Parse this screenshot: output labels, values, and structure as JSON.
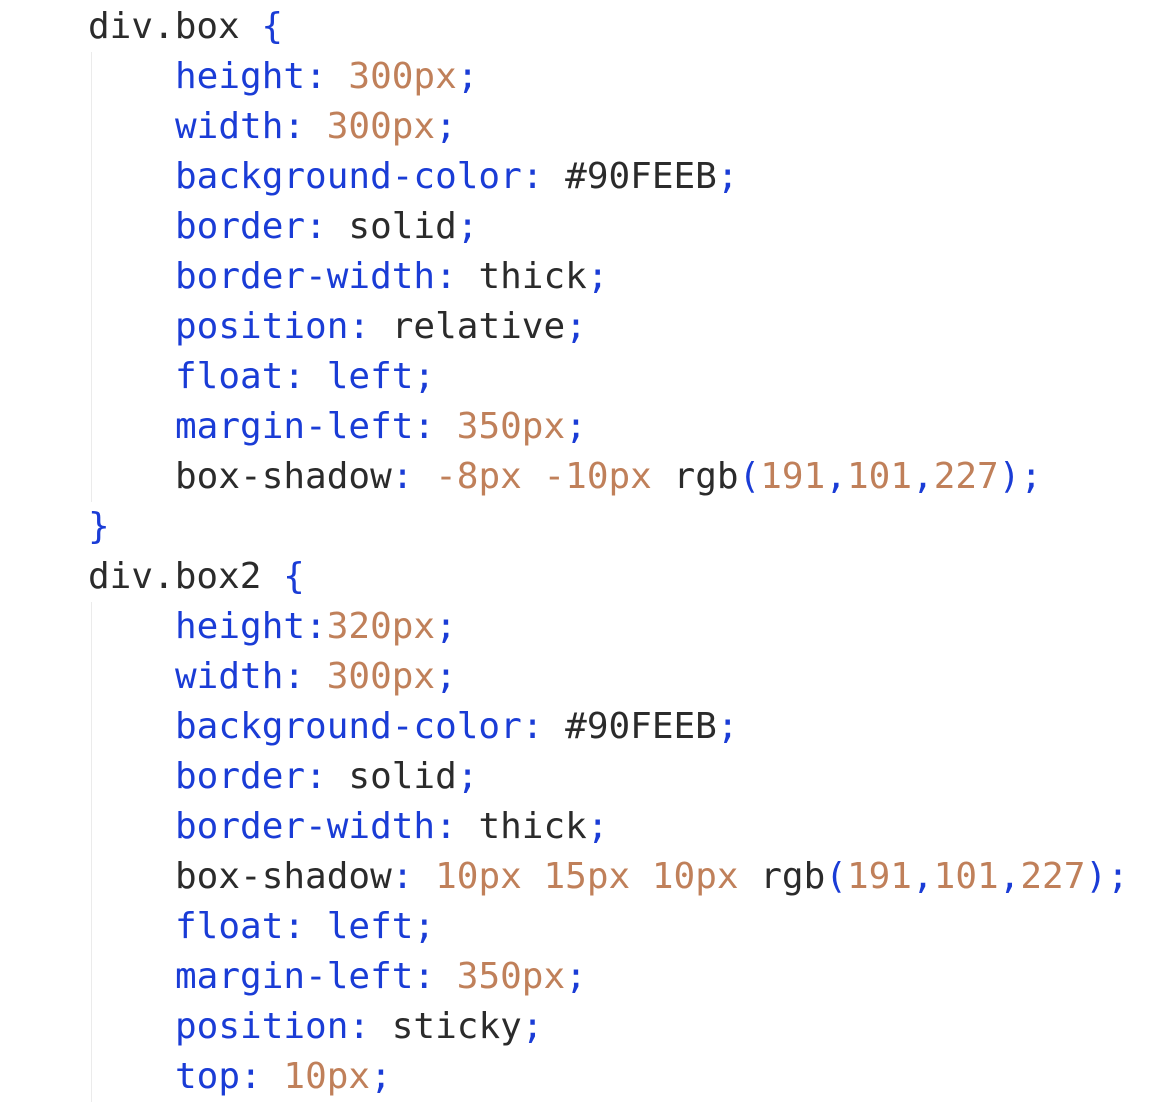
{
  "colors": {
    "selector": "#2b2b2b",
    "brace": "#1a3cd6",
    "property": "#1a3cd6",
    "punctuation": "#1a3cd6",
    "number": "#c0805a",
    "keyword": "#1a3cd6",
    "plain": "#2b2b2b",
    "background": "#ffffff"
  },
  "lines": [
    {
      "indent": false,
      "tokens": [
        {
          "t": "sel",
          "v": "div.box "
        },
        {
          "t": "brace",
          "v": "{"
        }
      ]
    },
    {
      "indent": true,
      "tokens": [
        {
          "t": "prop",
          "v": "height"
        },
        {
          "t": "punct",
          "v": ": "
        },
        {
          "t": "num",
          "v": "300px"
        },
        {
          "t": "punct",
          "v": ";"
        }
      ]
    },
    {
      "indent": true,
      "tokens": [
        {
          "t": "prop",
          "v": "width"
        },
        {
          "t": "punct",
          "v": ": "
        },
        {
          "t": "num",
          "v": "300px"
        },
        {
          "t": "punct",
          "v": ";"
        }
      ]
    },
    {
      "indent": true,
      "tokens": [
        {
          "t": "prop",
          "v": "background-color"
        },
        {
          "t": "punct",
          "v": ": "
        },
        {
          "t": "plain",
          "v": "#90FEEB"
        },
        {
          "t": "punct",
          "v": ";"
        }
      ]
    },
    {
      "indent": true,
      "tokens": [
        {
          "t": "prop",
          "v": "border"
        },
        {
          "t": "punct",
          "v": ": "
        },
        {
          "t": "plain",
          "v": "solid"
        },
        {
          "t": "punct",
          "v": ";"
        }
      ]
    },
    {
      "indent": true,
      "tokens": [
        {
          "t": "prop",
          "v": "border-width"
        },
        {
          "t": "punct",
          "v": ": "
        },
        {
          "t": "plain",
          "v": "thick"
        },
        {
          "t": "punct",
          "v": ";"
        }
      ]
    },
    {
      "indent": true,
      "tokens": [
        {
          "t": "prop",
          "v": "position"
        },
        {
          "t": "punct",
          "v": ": "
        },
        {
          "t": "plain",
          "v": "relative"
        },
        {
          "t": "punct",
          "v": ";"
        }
      ]
    },
    {
      "indent": true,
      "tokens": [
        {
          "t": "prop",
          "v": "float"
        },
        {
          "t": "punct",
          "v": ": "
        },
        {
          "t": "kw",
          "v": "left"
        },
        {
          "t": "punct",
          "v": ";"
        }
      ]
    },
    {
      "indent": true,
      "tokens": [
        {
          "t": "prop",
          "v": "margin-left"
        },
        {
          "t": "punct",
          "v": ": "
        },
        {
          "t": "num",
          "v": "350px"
        },
        {
          "t": "punct",
          "v": ";"
        }
      ]
    },
    {
      "indent": true,
      "tokens": [
        {
          "t": "plain",
          "v": "box-shadow"
        },
        {
          "t": "punct",
          "v": ": "
        },
        {
          "t": "num",
          "v": "-8px -10px "
        },
        {
          "t": "plain",
          "v": "rgb"
        },
        {
          "t": "punct",
          "v": "("
        },
        {
          "t": "num",
          "v": "191"
        },
        {
          "t": "punct",
          "v": ","
        },
        {
          "t": "num",
          "v": "101"
        },
        {
          "t": "punct",
          "v": ","
        },
        {
          "t": "num",
          "v": "227"
        },
        {
          "t": "punct",
          "v": ");"
        }
      ]
    },
    {
      "indent": false,
      "tokens": [
        {
          "t": "brace",
          "v": "}"
        }
      ]
    },
    {
      "indent": false,
      "tokens": [
        {
          "t": "sel",
          "v": "div.box2 "
        },
        {
          "t": "brace",
          "v": "{"
        }
      ]
    },
    {
      "indent": true,
      "tokens": [
        {
          "t": "prop",
          "v": "height"
        },
        {
          "t": "punct",
          "v": ":"
        },
        {
          "t": "num",
          "v": "320px"
        },
        {
          "t": "punct",
          "v": ";"
        }
      ]
    },
    {
      "indent": true,
      "tokens": [
        {
          "t": "prop",
          "v": "width"
        },
        {
          "t": "punct",
          "v": ": "
        },
        {
          "t": "num",
          "v": "300px"
        },
        {
          "t": "punct",
          "v": ";"
        }
      ]
    },
    {
      "indent": true,
      "tokens": [
        {
          "t": "prop",
          "v": "background-color"
        },
        {
          "t": "punct",
          "v": ": "
        },
        {
          "t": "plain",
          "v": "#90FEEB"
        },
        {
          "t": "punct",
          "v": ";"
        }
      ]
    },
    {
      "indent": true,
      "tokens": [
        {
          "t": "prop",
          "v": "border"
        },
        {
          "t": "punct",
          "v": ": "
        },
        {
          "t": "plain",
          "v": "solid"
        },
        {
          "t": "punct",
          "v": ";"
        }
      ]
    },
    {
      "indent": true,
      "tokens": [
        {
          "t": "prop",
          "v": "border-width"
        },
        {
          "t": "punct",
          "v": ": "
        },
        {
          "t": "plain",
          "v": "thick"
        },
        {
          "t": "punct",
          "v": ";"
        }
      ]
    },
    {
      "indent": true,
      "tokens": [
        {
          "t": "plain",
          "v": "box-shadow"
        },
        {
          "t": "punct",
          "v": ": "
        },
        {
          "t": "num",
          "v": "10px 15px 10px "
        },
        {
          "t": "plain",
          "v": "rgb"
        },
        {
          "t": "punct",
          "v": "("
        },
        {
          "t": "num",
          "v": "191"
        },
        {
          "t": "punct",
          "v": ","
        },
        {
          "t": "num",
          "v": "101"
        },
        {
          "t": "punct",
          "v": ","
        },
        {
          "t": "num",
          "v": "227"
        },
        {
          "t": "punct",
          "v": ");"
        }
      ]
    },
    {
      "indent": true,
      "tokens": [
        {
          "t": "prop",
          "v": "float"
        },
        {
          "t": "punct",
          "v": ": "
        },
        {
          "t": "kw",
          "v": "left"
        },
        {
          "t": "punct",
          "v": ";"
        }
      ]
    },
    {
      "indent": true,
      "tokens": [
        {
          "t": "prop",
          "v": "margin-left"
        },
        {
          "t": "punct",
          "v": ": "
        },
        {
          "t": "num",
          "v": "350px"
        },
        {
          "t": "punct",
          "v": ";"
        }
      ]
    },
    {
      "indent": true,
      "tokens": [
        {
          "t": "prop",
          "v": "position"
        },
        {
          "t": "punct",
          "v": ": "
        },
        {
          "t": "plain",
          "v": "sticky"
        },
        {
          "t": "punct",
          "v": ";"
        }
      ]
    },
    {
      "indent": true,
      "tokens": [
        {
          "t": "prop",
          "v": "top"
        },
        {
          "t": "punct",
          "v": ": "
        },
        {
          "t": "num",
          "v": "10px"
        },
        {
          "t": "punct",
          "v": ";"
        }
      ]
    }
  ]
}
